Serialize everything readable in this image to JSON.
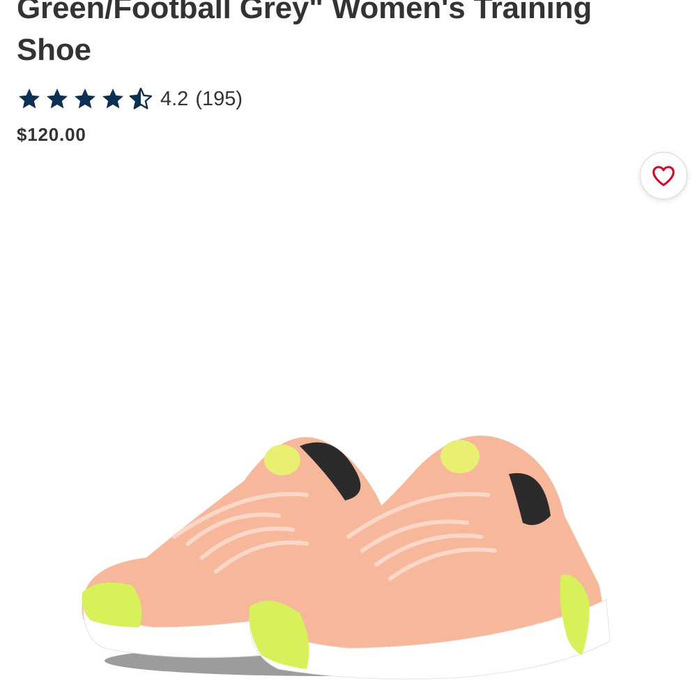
{
  "product": {
    "title": "Green/Football Grey\" Women's Training Shoe",
    "rating_value": "4.2",
    "review_count": "(195)",
    "rating_stars": 4.2,
    "price": "$120.00"
  },
  "favorite": {
    "icon": "heart-icon",
    "color": "#c8102e"
  },
  "colors": {
    "star": "#0b3052",
    "text": "#333333",
    "shoe_upper": "#f6b79b",
    "shoe_sole": "#ffffff",
    "shoe_accent": "#d8f05a"
  }
}
